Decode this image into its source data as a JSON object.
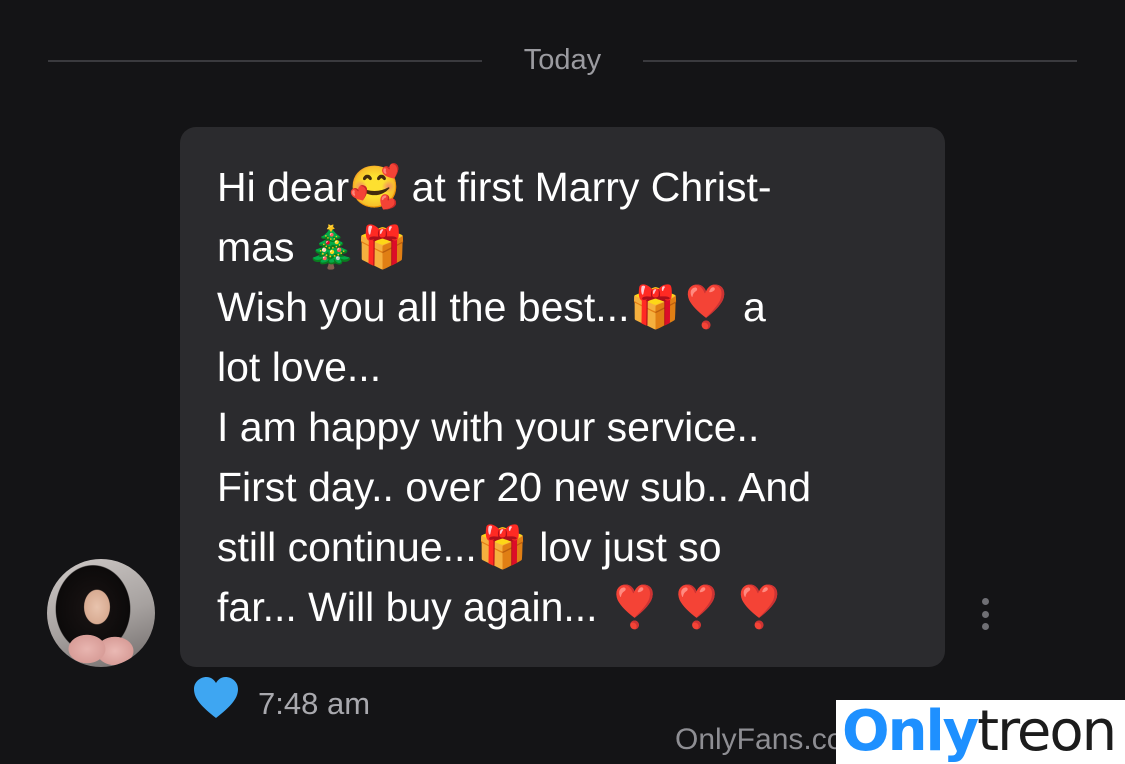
{
  "conversation": {
    "date_divider": "Today",
    "message": {
      "text": "Hi dear🥰 at first Marry Christ-\nmas 🎄🎁\nWish you all the best...🎁❣️ a\nlot love...\nI am happy with your service..\nFirst day.. over 20 new sub.. And\nstill continue...🎁 lov just so\nfar... Will buy again... ❣️ ❣️ ❣️",
      "time": "7:48 am",
      "liked": true
    }
  },
  "icons": {
    "like": "heart-icon",
    "options": "more-vertical-icon"
  },
  "watermarks": {
    "site": "OnlyFans.com",
    "logo_part_1": "Only",
    "logo_part_2": "treon"
  },
  "colors": {
    "background": "#141416",
    "bubble": "#2b2b2e",
    "heart": "#3ea6f2",
    "logo_blue": "#1e90ff"
  }
}
